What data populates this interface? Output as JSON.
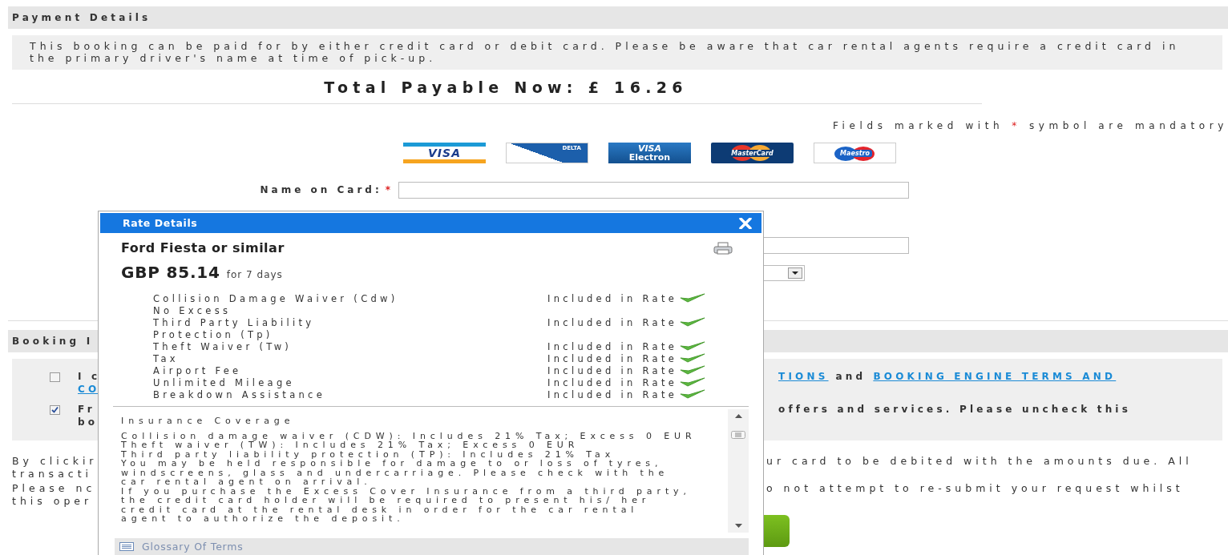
{
  "payment_header": "Payment Details",
  "notice": "This booking can be paid for by either credit card or debit card. Please be aware that car rental agents require a credit card in the primary driver's name at time of pick-up.",
  "total": "Total Payable Now: £ 16.26",
  "mandatory_note": {
    "before": "Fields marked with",
    "mark": "*",
    "after": "symbol are mandatory"
  },
  "card_logos": [
    {
      "kind": "visa",
      "label": "VISA"
    },
    {
      "kind": "delta",
      "label": "DELTA"
    },
    {
      "kind": "visa-electron",
      "label": "VISA",
      "sublabel": "Electron"
    },
    {
      "kind": "mastercard",
      "label": "MasterCard"
    },
    {
      "kind": "maestro",
      "label": "Maestro"
    }
  ],
  "name_on_card": {
    "label": "Name on Card:",
    "required_mark": "*"
  },
  "booking_header": "Booking I",
  "consents": [
    {
      "checked": false,
      "left_lines": [
        [
          {
            "text": "I c",
            "link": false
          }
        ],
        [
          {
            "text": "CO",
            "link": true
          }
        ]
      ],
      "right_lines": [
        [
          {
            "text": "TIONS",
            "link": true
          },
          {
            "text": "and",
            "link": false
          },
          {
            "text": "BOOKING ENGINE TERMS AND",
            "link": true
          }
        ]
      ]
    },
    {
      "checked": true,
      "left_lines": [
        [
          {
            "text": "Fr",
            "link": false
          }
        ],
        [
          {
            "text": "bo",
            "link": false
          }
        ]
      ],
      "right_lines": [
        [
          {
            "text": "offers and services. Please uncheck this",
            "link": false
          }
        ]
      ]
    }
  ],
  "notes": [
    {
      "left_lines": [
        "By clickir",
        "transacti"
      ],
      "right_lines": [
        "ur card to be debited with the amounts due. All"
      ]
    },
    {
      "left_lines": [
        "Please nc",
        "this oper"
      ],
      "right_lines": [
        "o not attempt to re-submit your request whilst"
      ]
    }
  ],
  "rate_modal": {
    "title": "Rate Details",
    "car": "Ford Fiesta or similar",
    "price": "GBP 85.14",
    "price_note": "for 7 days",
    "rates": [
      {
        "name_lines": [
          "Collision Damage Waiver (Cdw)",
          "No Excess"
        ],
        "status": "Included in Rate",
        "included": true
      },
      {
        "name_lines": [
          "Third Party Liability",
          "Protection (Tp)"
        ],
        "status": "Included in Rate",
        "included": true
      },
      {
        "name_lines": [
          "Theft Waiver (Tw)"
        ],
        "status": "Included in Rate",
        "included": true
      },
      {
        "name_lines": [
          "Tax"
        ],
        "status": "Included in Rate",
        "included": true
      },
      {
        "name_lines": [
          "Airport Fee"
        ],
        "status": "Included in Rate",
        "included": true
      },
      {
        "name_lines": [
          "Unlimited Mileage"
        ],
        "status": "Included in Rate",
        "included": true
      },
      {
        "name_lines": [
          "Breakdown Assistance"
        ],
        "status": "Included in Rate",
        "included": true
      }
    ],
    "coverage_heading": "Insurance Coverage",
    "coverage_lines": [
      "Collision damage waiver (CDW): Includes 21% Tax; Excess 0 EUR",
      "Theft waiver (TW): Includes 21% Tax; Excess 0 EUR",
      "Third party liability protection (TP): Includes 21% Tax",
      "You may be held responsible for damage to or loss of tyres,",
      "windscreens, glass and undercarriage. Please check with the",
      "car rental agent on arrival.",
      "If you purchase the Excess Cover Insurance from a third party,",
      "the credit card holder will be required to present his/ her",
      "credit card at the rental desk in order for the car rental",
      "agent to authorize the deposit."
    ],
    "glossary_link": "Glossary Of Terms"
  }
}
